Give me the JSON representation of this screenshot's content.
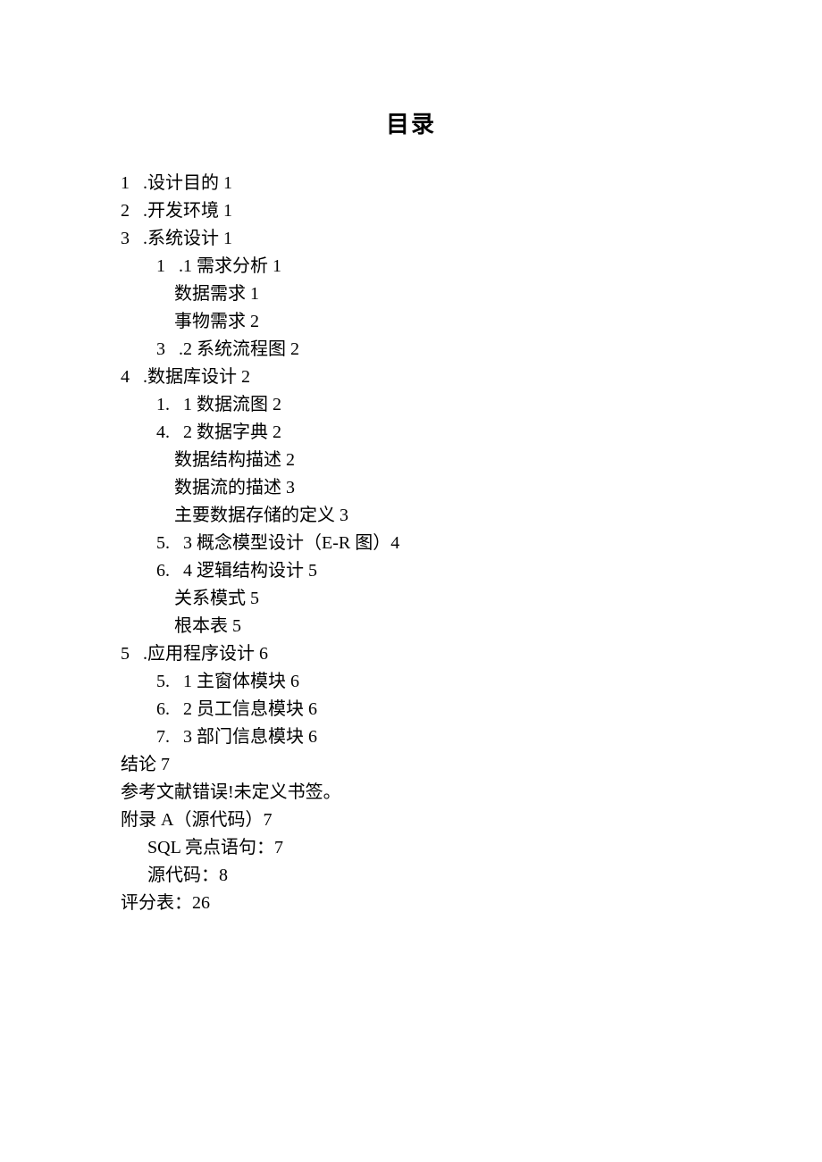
{
  "title": "目录",
  "toc": {
    "e1": "1   .设计目的 1",
    "e2": "2   .开发环境 1",
    "e3": "3   .系统设计 1",
    "e4": "1   .1 需求分析 1",
    "e5": "数据需求 1",
    "e6": "事物需求 2",
    "e7": "3   .2 系统流程图 2",
    "e8": "4   .数据库设计 2",
    "e9": "1.   1 数据流图 2",
    "e10": "4.   2 数据字典 2",
    "e11": "数据结构描述 2",
    "e12": "数据流的描述 3",
    "e13": "主要数据存储的定义 3",
    "e14": "5.   3 概念模型设计（E-R 图）4",
    "e15": "6.   4 逻辑结构设计 5",
    "e16": "关系模式 5",
    "e17": "根本表 5",
    "e18": "5   .应用程序设计 6",
    "e19": "5.   1 主窗体模块 6",
    "e20": "6.   2 员工信息模块 6",
    "e21": "7.   3 部门信息模块 6",
    "e22": "结论 7",
    "e23": "参考文献错误!未定义书签。",
    "e24": "附录 A（源代码）7",
    "e25": "SQL 亮点语句：7",
    "e26": "源代码：8",
    "e27": "评分表：26"
  }
}
